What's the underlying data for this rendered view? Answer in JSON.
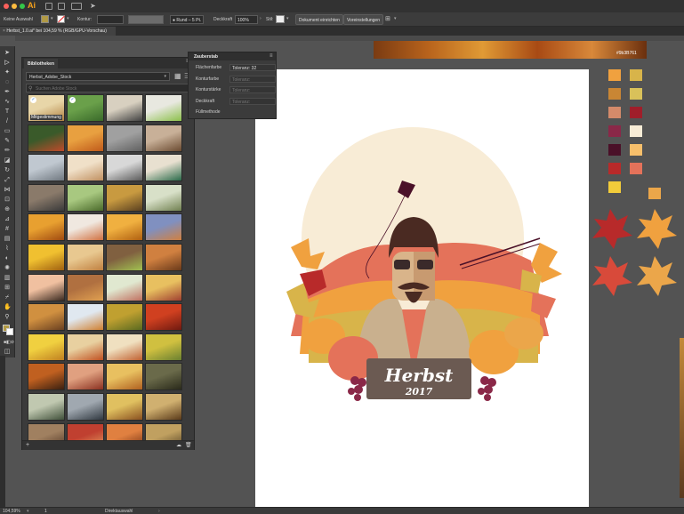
{
  "app": {
    "logo": "Ai"
  },
  "control_bar": {
    "selection_label": "Keine Auswahl",
    "stroke_label": "Kontur:",
    "brush_label": "Rund – 5 Pt.",
    "opacity_label": "Deckkraft",
    "opacity_value": "100%",
    "style_label": "Stil:",
    "doc_setup_button": "Dokument einrichten",
    "preferences_button": "Voreinstellungen"
  },
  "document_tab": {
    "title": "Herbst_1.0.ai* bei 104,59 % (RGB/GPU-Vorschau)"
  },
  "libraries_panel": {
    "tab": "Bibliotheken",
    "library_name": "Herbst_Adobe_Stock",
    "search_placeholder": "Suchen Adobe Stock",
    "first_item_caption": "Mitgestimmung"
  },
  "overlay_panel": {
    "title": "Zauberstab",
    "rows": [
      {
        "label": "Flächenfarbe",
        "field_label": "Toleranz:",
        "value": "32"
      },
      {
        "label": "Konturfarbe",
        "field_label": "Toleranz:",
        "value": ""
      },
      {
        "label": "Konturstärke",
        "field_label": "Toleranz:",
        "value": ""
      },
      {
        "label": "Deckkraft",
        "field_label": "Toleranz:",
        "value": ""
      },
      {
        "label": "Füllmethode",
        "field_label": "",
        "value": ""
      }
    ]
  },
  "color_chip": {
    "hex": "#9b3B761"
  },
  "swatches": [
    "#f0a13f",
    "#d8b44a",
    "#c98634",
    "#d9c15a",
    "#d48a6a",
    "#a01e2a",
    "#8a2848",
    "#f8ecd6",
    "#4a1028",
    "#f7bf6b",
    "#b82a2a",
    "#e4725a",
    "#f2cc3a",
    "#eba64a"
  ],
  "artwork": {
    "plate_title": "Herbst",
    "plate_year": "2017"
  },
  "status_bar": {
    "zoom": "104,59%",
    "artboard_num": "1",
    "tool_name": "Direktauswahl"
  }
}
